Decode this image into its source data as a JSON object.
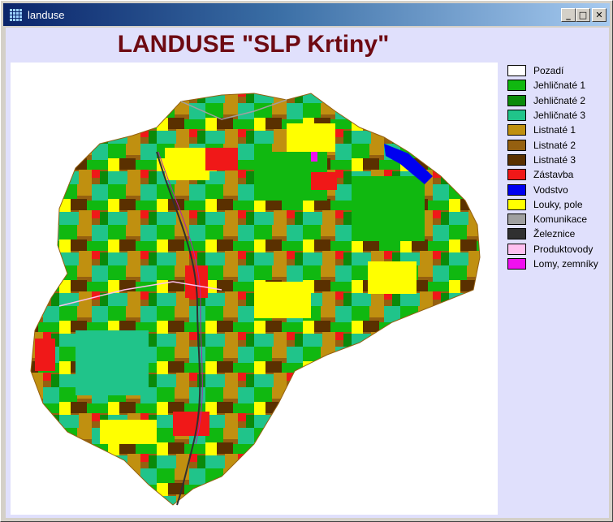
{
  "window": {
    "title": "landuse",
    "controls": {
      "minimize": "_",
      "maximize": "□",
      "close": "✕"
    }
  },
  "map": {
    "title": "LANDUSE \"SLP Krtiny\""
  },
  "legend": [
    {
      "label": "Pozadí",
      "color": "#ffffff"
    },
    {
      "label": "Jehličnaté 1",
      "color": "#10b810"
    },
    {
      "label": "Jehličnaté 2",
      "color": "#0a8a0a"
    },
    {
      "label": "Jehličnaté 3",
      "color": "#20c48a"
    },
    {
      "label": "Listnaté 1",
      "color": "#c09010"
    },
    {
      "label": "Listnaté 2",
      "color": "#956010"
    },
    {
      "label": "Listnaté 3",
      "color": "#5a3000"
    },
    {
      "label": "Zástavba",
      "color": "#f01818"
    },
    {
      "label": "Vodstvo",
      "color": "#0000f0"
    },
    {
      "label": "Louky, pole",
      "color": "#ffff00"
    },
    {
      "label": "Komunikace",
      "color": "#a0a0a0"
    },
    {
      "label": "Železnice",
      "color": "#303030"
    },
    {
      "label": "Produktovody",
      "color": "#ffc0f0"
    },
    {
      "label": "Lomy, zemníky",
      "color": "#f010f0"
    }
  ]
}
